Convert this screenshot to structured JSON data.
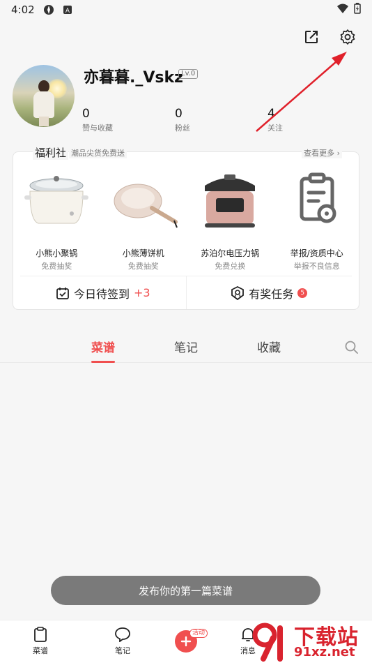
{
  "status_bar": {
    "time": "4:02"
  },
  "profile": {
    "username": "亦暮暮._Vskz",
    "level": "Lv.0",
    "stats": [
      {
        "value": "0",
        "label": "赞与收藏"
      },
      {
        "value": "0",
        "label": "粉丝"
      },
      {
        "value": "4",
        "label": "关注"
      }
    ]
  },
  "welfare": {
    "title": "福利社",
    "subtitle": "潮品尖货免费送",
    "more": "查看更多 ›",
    "products": [
      {
        "name": "小熊小聚锅",
        "desc": "免费抽奖",
        "icon": "hot-pot-image"
      },
      {
        "name": "小熊薄饼机",
        "desc": "免费抽奖",
        "icon": "crepe-maker-image"
      },
      {
        "name": "苏泊尔电压力锅",
        "desc": "免费兑换",
        "icon": "pressure-cooker-image"
      },
      {
        "name": "举报/资质中心",
        "desc": "举报不良信息",
        "icon": "report-clipboard-icon"
      }
    ],
    "checkin": {
      "label": "今日待签到",
      "bonus": "+3"
    },
    "tasks": {
      "label": "有奖任务",
      "badge": "5"
    }
  },
  "tabs": [
    {
      "label": "菜谱",
      "active": true
    },
    {
      "label": "笔记",
      "active": false
    },
    {
      "label": "收藏",
      "active": false
    }
  ],
  "toast": "发布你的第一篇菜谱",
  "bottom_nav": {
    "items": [
      {
        "label": "菜谱",
        "icon": "clipboard-icon"
      },
      {
        "label": "笔记",
        "icon": "chat-bubble-icon"
      },
      {
        "label": "消息",
        "icon": "bell-icon"
      }
    ],
    "publish_tag": "活动"
  },
  "watermark": {
    "title": "下载站",
    "url": "91xz.net"
  },
  "colors": {
    "accent": "#f04f4f",
    "watermark": "#d9232e"
  }
}
